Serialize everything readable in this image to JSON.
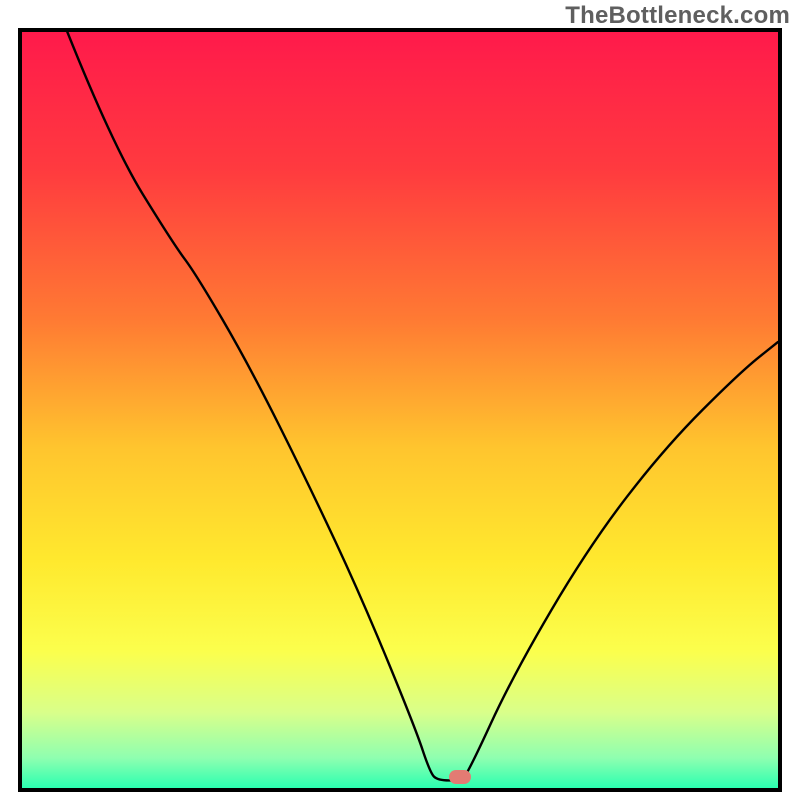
{
  "watermark": "TheBottleneck.com",
  "chart_data": {
    "type": "area",
    "title": "",
    "xlabel": "",
    "ylabel": "",
    "xlim": [
      0,
      100
    ],
    "ylim": [
      0,
      100
    ],
    "gradient_stops": [
      {
        "offset": 0,
        "color": "#ff1a4b"
      },
      {
        "offset": 18,
        "color": "#ff3a3f"
      },
      {
        "offset": 38,
        "color": "#ff7a33"
      },
      {
        "offset": 55,
        "color": "#ffc52e"
      },
      {
        "offset": 70,
        "color": "#ffe92e"
      },
      {
        "offset": 82,
        "color": "#fbff4d"
      },
      {
        "offset": 90,
        "color": "#d9ff8a"
      },
      {
        "offset": 96,
        "color": "#8fffb0"
      },
      {
        "offset": 100,
        "color": "#2bffb0"
      }
    ],
    "curve": {
      "comment": "y = bottleneck percentage (100 top, 0 bottom); x = relative hardware balance 0..100",
      "points": [
        {
          "x": 6,
          "y": 100
        },
        {
          "x": 12,
          "y": 85
        },
        {
          "x": 20,
          "y": 72
        },
        {
          "x": 23,
          "y": 68
        },
        {
          "x": 30,
          "y": 56
        },
        {
          "x": 38,
          "y": 40
        },
        {
          "x": 45,
          "y": 25
        },
        {
          "x": 52,
          "y": 8
        },
        {
          "x": 54,
          "y": 2
        },
        {
          "x": 55,
          "y": 1
        },
        {
          "x": 58,
          "y": 1
        },
        {
          "x": 59,
          "y": 2
        },
        {
          "x": 65,
          "y": 15
        },
        {
          "x": 75,
          "y": 32
        },
        {
          "x": 85,
          "y": 45
        },
        {
          "x": 95,
          "y": 55
        },
        {
          "x": 100,
          "y": 59
        }
      ]
    },
    "marker": {
      "x": 58,
      "y": 1.5,
      "color": "#e37b73"
    }
  }
}
